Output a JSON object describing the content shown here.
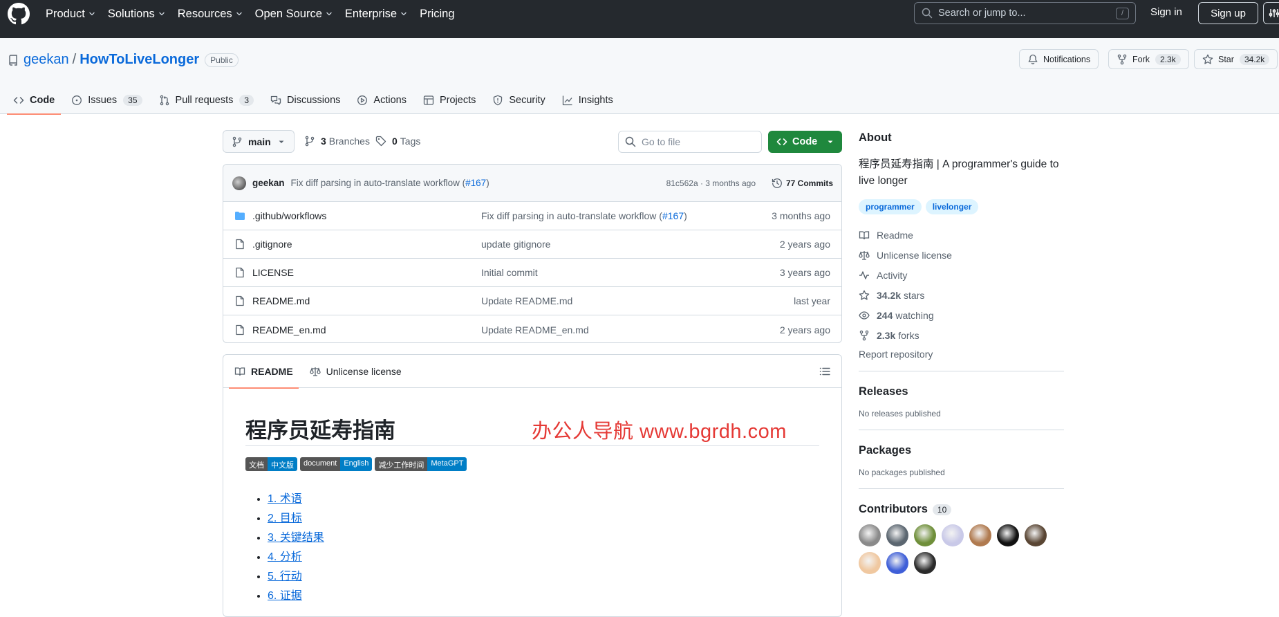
{
  "header": {
    "nav": [
      "Product",
      "Solutions",
      "Resources",
      "Open Source",
      "Enterprise",
      "Pricing"
    ],
    "nav_dropdowns": [
      true,
      true,
      true,
      true,
      true,
      false
    ],
    "search_placeholder": "Search or jump to...",
    "search_shortcut": "/",
    "sign_in": "Sign in",
    "sign_up": "Sign up"
  },
  "repo": {
    "owner": "geekan",
    "separator": "/",
    "name": "HowToLiveLonger",
    "visibility": "Public",
    "notifications_label": "Notifications",
    "fork_label": "Fork",
    "fork_count": "2.3k",
    "star_label": "Star",
    "star_count": "34.2k"
  },
  "tabs": [
    {
      "label": "Code",
      "count": "",
      "icon": "code-icon",
      "active": true
    },
    {
      "label": "Issues",
      "count": "35",
      "icon": "issue-opened-icon"
    },
    {
      "label": "Pull requests",
      "count": "3",
      "icon": "git-pull-request-icon"
    },
    {
      "label": "Discussions",
      "count": "",
      "icon": "comment-discussion-icon"
    },
    {
      "label": "Actions",
      "count": "",
      "icon": "play-icon"
    },
    {
      "label": "Projects",
      "count": "",
      "icon": "table-icon"
    },
    {
      "label": "Security",
      "count": "",
      "icon": "shield-icon"
    },
    {
      "label": "Insights",
      "count": "",
      "icon": "graph-icon"
    }
  ],
  "toolbar": {
    "branch": "main",
    "branches_count": "3",
    "branches_label": "Branches",
    "tags_count": "0",
    "tags_label": "Tags",
    "go_to_file_placeholder": "Go to file",
    "code_button": "Code"
  },
  "latest_commit": {
    "author": "geekan",
    "message": "Fix diff parsing in auto-translate workflow (",
    "pr": "#167",
    "message_end": ")",
    "sha_time": "81c562a · 3 months ago",
    "commits_label": "77 Commits"
  },
  "files": [
    {
      "name": ".github/workflows",
      "type": "folder",
      "message": "Fix diff parsing in auto-translate workflow (",
      "pr": "#167",
      "message_end": ")",
      "date": "3 months ago"
    },
    {
      "name": ".gitignore",
      "type": "file",
      "message": "update gitignore",
      "pr": "",
      "message_end": "",
      "date": "2 years ago"
    },
    {
      "name": "LICENSE",
      "type": "file",
      "message": "Initial commit",
      "pr": "",
      "message_end": "",
      "date": "3 years ago"
    },
    {
      "name": "README.md",
      "type": "file",
      "message": "Update README.md",
      "pr": "",
      "message_end": "",
      "date": "last year"
    },
    {
      "name": "README_en.md",
      "type": "file",
      "message": "Update README_en.md",
      "pr": "",
      "message_end": "",
      "date": "2 years ago"
    }
  ],
  "readme": {
    "tab_readme": "README",
    "tab_license": "Unlicense license",
    "title": "程序员延寿指南",
    "watermark": "办公人导航  www.bgrdh.com",
    "shields": [
      {
        "left": "文档",
        "right": "中文版"
      },
      {
        "left": "document",
        "right": "English"
      },
      {
        "left": "减少工作时间",
        "right": "MetaGPT"
      }
    ],
    "toc": [
      "1. 术语",
      "2. 目标",
      "3. 关键结果",
      "4. 分析",
      "5. 行动",
      "6. 证据"
    ]
  },
  "sidebar": {
    "about_title": "About",
    "description": "程序员延寿指南 | A programmer's guide to live longer",
    "topics": [
      "programmer",
      "livelonger"
    ],
    "readme": "Readme",
    "license": "Unlicense license",
    "activity": "Activity",
    "stars_count": "34.2k",
    "stars_label": "stars",
    "watching_count": "244",
    "watching_label": "watching",
    "forks_count": "2.3k",
    "forks_label": "forks",
    "report": "Report repository",
    "releases_title": "Releases",
    "releases_text": "No releases published",
    "packages_title": "Packages",
    "packages_text": "No packages published",
    "contributors_title": "Contributors",
    "contributors_count": "10"
  },
  "contributor_avatar_colors": [
    "#8a8a8a",
    "#5b6670",
    "#6f8f3a",
    "#c9c9e8",
    "#b07a4f",
    "#111111",
    "#5a4634",
    "#f0c8a0",
    "#3f5fd8",
    "#2b2b2b"
  ]
}
